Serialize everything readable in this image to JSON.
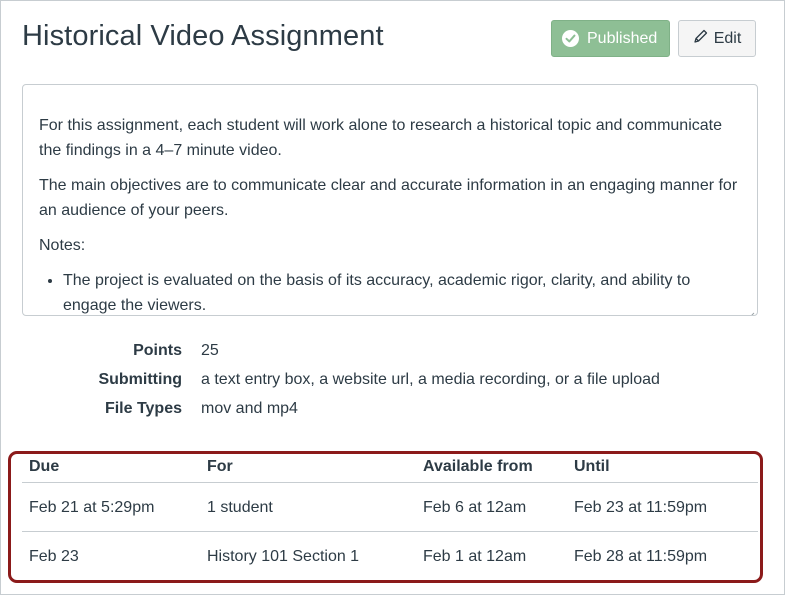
{
  "page": {
    "title": "Historical Video Assignment"
  },
  "header": {
    "published_label": "Published",
    "edit_label": "Edit"
  },
  "description": {
    "paragraphs": [
      "For this assignment, each student will work alone to research a historical topic and communicate the findings in a 4–7 minute video.",
      "The main objectives are to communicate clear and accurate information in an engaging manner for an audience of your peers.",
      "Notes:"
    ],
    "bullets": [
      "The project is evaluated on the basis of its accuracy, academic rigor, clarity, and ability to engage the viewers."
    ]
  },
  "details": {
    "points_label": "Points",
    "points_value": "25",
    "submitting_label": "Submitting",
    "submitting_value": "a text entry box, a website url, a media recording, or a file upload",
    "file_types_label": "File Types",
    "file_types_value": "mov and mp4"
  },
  "dates": {
    "headers": [
      "Due",
      "For",
      "Available from",
      "Until"
    ],
    "rows": [
      [
        "Feb 21 at 5:29pm",
        "1 student",
        "Feb 6 at 12am",
        "Feb 23 at 11:59pm"
      ],
      [
        "Feb 23",
        "History 101 Section 1",
        "Feb 1 at 12am",
        "Feb 28 at 11:59pm"
      ]
    ]
  },
  "colors": {
    "published_bg": "#8ebf95",
    "highlight_border": "#8b1a1a",
    "text": "#2d3b45"
  },
  "icons": {
    "published": "check-circle-icon",
    "edit": "pencil-icon"
  }
}
